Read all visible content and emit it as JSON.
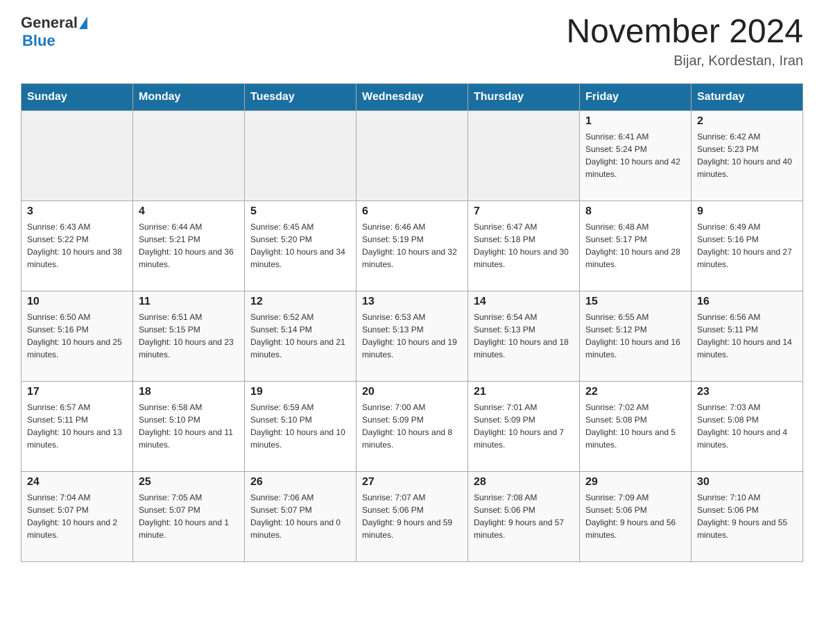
{
  "header": {
    "logo_general": "General",
    "logo_blue": "Blue",
    "month_title": "November 2024",
    "subtitle": "Bijar, Kordestan, Iran"
  },
  "days_of_week": [
    "Sunday",
    "Monday",
    "Tuesday",
    "Wednesday",
    "Thursday",
    "Friday",
    "Saturday"
  ],
  "weeks": [
    [
      {
        "day": "",
        "info": ""
      },
      {
        "day": "",
        "info": ""
      },
      {
        "day": "",
        "info": ""
      },
      {
        "day": "",
        "info": ""
      },
      {
        "day": "",
        "info": ""
      },
      {
        "day": "1",
        "info": "Sunrise: 6:41 AM\nSunset: 5:24 PM\nDaylight: 10 hours and 42 minutes."
      },
      {
        "day": "2",
        "info": "Sunrise: 6:42 AM\nSunset: 5:23 PM\nDaylight: 10 hours and 40 minutes."
      }
    ],
    [
      {
        "day": "3",
        "info": "Sunrise: 6:43 AM\nSunset: 5:22 PM\nDaylight: 10 hours and 38 minutes."
      },
      {
        "day": "4",
        "info": "Sunrise: 6:44 AM\nSunset: 5:21 PM\nDaylight: 10 hours and 36 minutes."
      },
      {
        "day": "5",
        "info": "Sunrise: 6:45 AM\nSunset: 5:20 PM\nDaylight: 10 hours and 34 minutes."
      },
      {
        "day": "6",
        "info": "Sunrise: 6:46 AM\nSunset: 5:19 PM\nDaylight: 10 hours and 32 minutes."
      },
      {
        "day": "7",
        "info": "Sunrise: 6:47 AM\nSunset: 5:18 PM\nDaylight: 10 hours and 30 minutes."
      },
      {
        "day": "8",
        "info": "Sunrise: 6:48 AM\nSunset: 5:17 PM\nDaylight: 10 hours and 28 minutes."
      },
      {
        "day": "9",
        "info": "Sunrise: 6:49 AM\nSunset: 5:16 PM\nDaylight: 10 hours and 27 minutes."
      }
    ],
    [
      {
        "day": "10",
        "info": "Sunrise: 6:50 AM\nSunset: 5:16 PM\nDaylight: 10 hours and 25 minutes."
      },
      {
        "day": "11",
        "info": "Sunrise: 6:51 AM\nSunset: 5:15 PM\nDaylight: 10 hours and 23 minutes."
      },
      {
        "day": "12",
        "info": "Sunrise: 6:52 AM\nSunset: 5:14 PM\nDaylight: 10 hours and 21 minutes."
      },
      {
        "day": "13",
        "info": "Sunrise: 6:53 AM\nSunset: 5:13 PM\nDaylight: 10 hours and 19 minutes."
      },
      {
        "day": "14",
        "info": "Sunrise: 6:54 AM\nSunset: 5:13 PM\nDaylight: 10 hours and 18 minutes."
      },
      {
        "day": "15",
        "info": "Sunrise: 6:55 AM\nSunset: 5:12 PM\nDaylight: 10 hours and 16 minutes."
      },
      {
        "day": "16",
        "info": "Sunrise: 6:56 AM\nSunset: 5:11 PM\nDaylight: 10 hours and 14 minutes."
      }
    ],
    [
      {
        "day": "17",
        "info": "Sunrise: 6:57 AM\nSunset: 5:11 PM\nDaylight: 10 hours and 13 minutes."
      },
      {
        "day": "18",
        "info": "Sunrise: 6:58 AM\nSunset: 5:10 PM\nDaylight: 10 hours and 11 minutes."
      },
      {
        "day": "19",
        "info": "Sunrise: 6:59 AM\nSunset: 5:10 PM\nDaylight: 10 hours and 10 minutes."
      },
      {
        "day": "20",
        "info": "Sunrise: 7:00 AM\nSunset: 5:09 PM\nDaylight: 10 hours and 8 minutes."
      },
      {
        "day": "21",
        "info": "Sunrise: 7:01 AM\nSunset: 5:09 PM\nDaylight: 10 hours and 7 minutes."
      },
      {
        "day": "22",
        "info": "Sunrise: 7:02 AM\nSunset: 5:08 PM\nDaylight: 10 hours and 5 minutes."
      },
      {
        "day": "23",
        "info": "Sunrise: 7:03 AM\nSunset: 5:08 PM\nDaylight: 10 hours and 4 minutes."
      }
    ],
    [
      {
        "day": "24",
        "info": "Sunrise: 7:04 AM\nSunset: 5:07 PM\nDaylight: 10 hours and 2 minutes."
      },
      {
        "day": "25",
        "info": "Sunrise: 7:05 AM\nSunset: 5:07 PM\nDaylight: 10 hours and 1 minute."
      },
      {
        "day": "26",
        "info": "Sunrise: 7:06 AM\nSunset: 5:07 PM\nDaylight: 10 hours and 0 minutes."
      },
      {
        "day": "27",
        "info": "Sunrise: 7:07 AM\nSunset: 5:06 PM\nDaylight: 9 hours and 59 minutes."
      },
      {
        "day": "28",
        "info": "Sunrise: 7:08 AM\nSunset: 5:06 PM\nDaylight: 9 hours and 57 minutes."
      },
      {
        "day": "29",
        "info": "Sunrise: 7:09 AM\nSunset: 5:06 PM\nDaylight: 9 hours and 56 minutes."
      },
      {
        "day": "30",
        "info": "Sunrise: 7:10 AM\nSunset: 5:06 PM\nDaylight: 9 hours and 55 minutes."
      }
    ]
  ]
}
